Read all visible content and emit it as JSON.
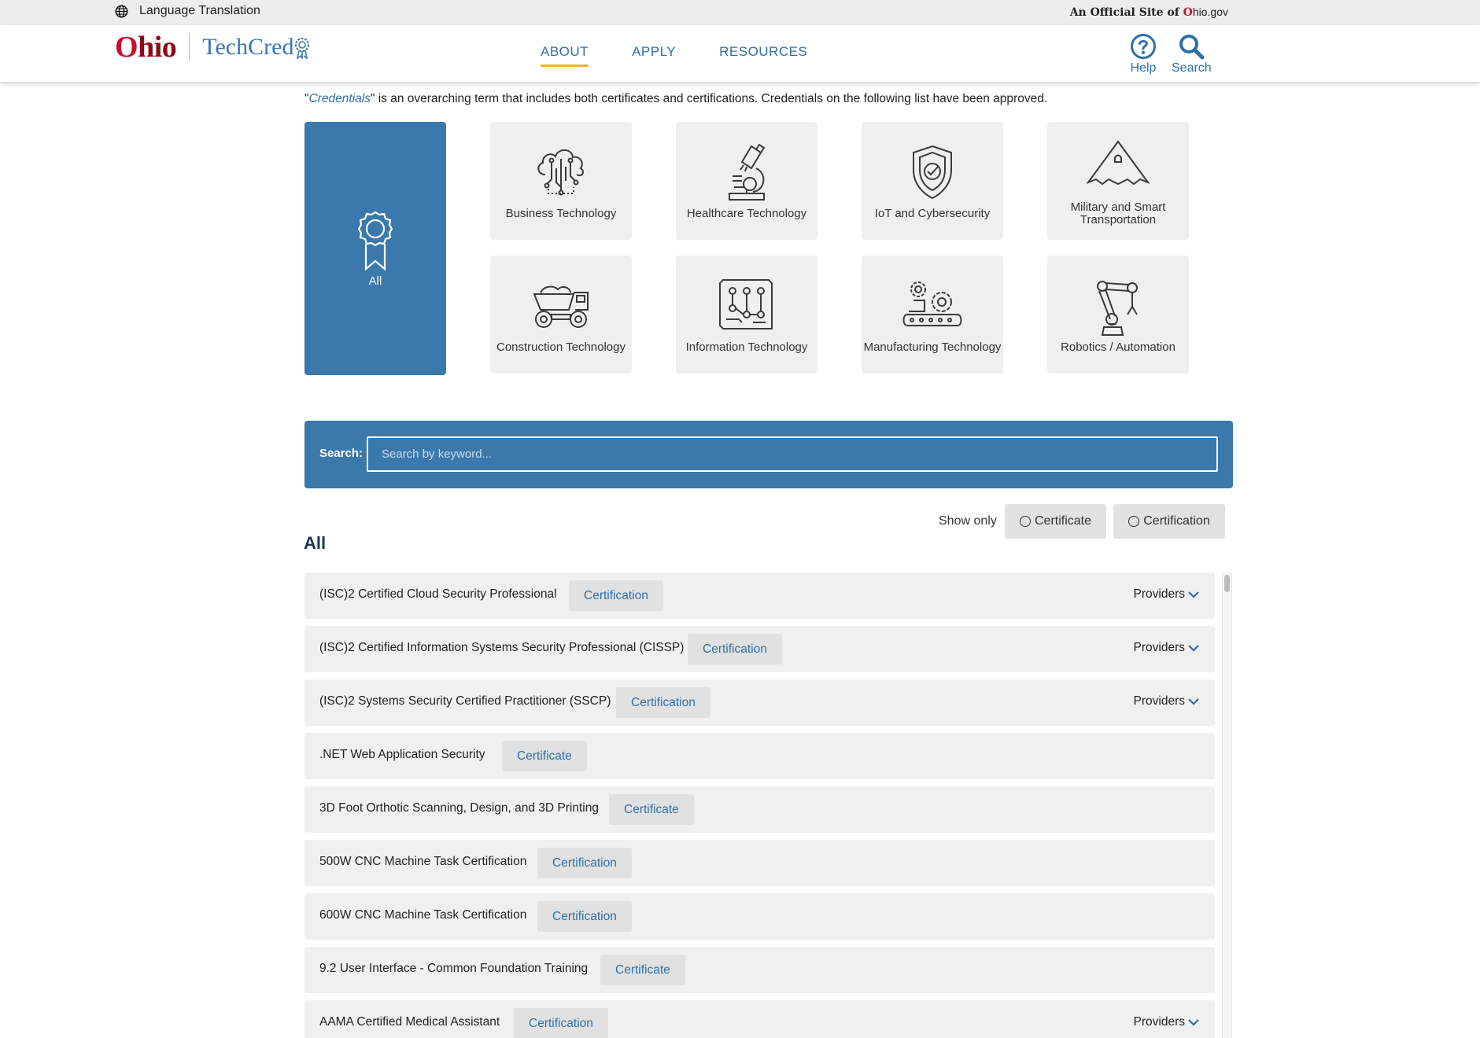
{
  "utility": {
    "language_label": "Language Translation",
    "official_prefix": "An Official Site of",
    "official_o": "O",
    "official_hio": "hio",
    "official_gov": ".gov"
  },
  "header": {
    "brand_o": "O",
    "brand_hio": "hio",
    "brand_techcred": "TechCred",
    "nav": [
      "ABOUT",
      "APPLY",
      "RESOURCES"
    ],
    "active_nav": "ABOUT",
    "help_label": "Help",
    "search_label": "Search"
  },
  "intro": {
    "quote_open": "\"",
    "credentials_link": "Credentials",
    "rest": "\" is an overarching term that includes both certificates and certifications. Credentials on the following list have been approved."
  },
  "categories": [
    {
      "label": "All",
      "icon": "award-ribbon-icon",
      "selected": true
    },
    {
      "label": "Business Technology",
      "icon": "cloud-network-icon"
    },
    {
      "label": "Healthcare Technology",
      "icon": "microscope-icon"
    },
    {
      "label": "IoT and Cybersecurity",
      "icon": "shield-check-icon"
    },
    {
      "label": "Military and Smart Transportation",
      "icon": "stealth-jet-icon"
    },
    {
      "label": "Construction Technology",
      "icon": "dump-truck-icon"
    },
    {
      "label": "Information Technology",
      "icon": "circuit-board-icon"
    },
    {
      "label": "Manufacturing Technology",
      "icon": "conveyor-gears-icon"
    },
    {
      "label": "Robotics / Automation",
      "icon": "robot-arm-icon"
    }
  ],
  "search": {
    "label": "Search:",
    "placeholder": "Search by keyword..."
  },
  "filters": {
    "show_only_label": "Show only",
    "options": [
      "Certificate",
      "Certification"
    ]
  },
  "section_title": "All",
  "credentials": [
    {
      "name": "(ISC)2 Certified Cloud Security Professional",
      "type": "Certification",
      "providers": "Providers"
    },
    {
      "name": "(ISC)2 Certified Information Systems Security Professional (CISSP)",
      "type": "Certification",
      "providers": "Providers"
    },
    {
      "name": "(ISC)2 Systems Security Certified Practitioner (SSCP)",
      "type": "Certification",
      "providers": "Providers"
    },
    {
      "name": ".NET Web Application Security",
      "type": "Certificate",
      "providers": ""
    },
    {
      "name": "3D Foot Orthotic Scanning, Design, and 3D Printing",
      "type": "Certificate",
      "providers": ""
    },
    {
      "name": "500W CNC Machine Task Certification",
      "type": "Certification",
      "providers": ""
    },
    {
      "name": "600W CNC Machine Task Certification",
      "type": "Certification",
      "providers": ""
    },
    {
      "name": "9.2 User Interface - Common Foundation Training",
      "type": "Certificate",
      "providers": ""
    },
    {
      "name": "AAMA Certified Medical Assistant",
      "type": "Certification",
      "providers": "Providers"
    }
  ],
  "colors": {
    "primary_blue": "#3b78ab",
    "link_blue": "#2f6fa8",
    "ohio_red": "#c8102e",
    "ohio_dark_red": "#8b0a1a",
    "active_underline": "#f0b429",
    "tile_gray": "#efefef"
  }
}
